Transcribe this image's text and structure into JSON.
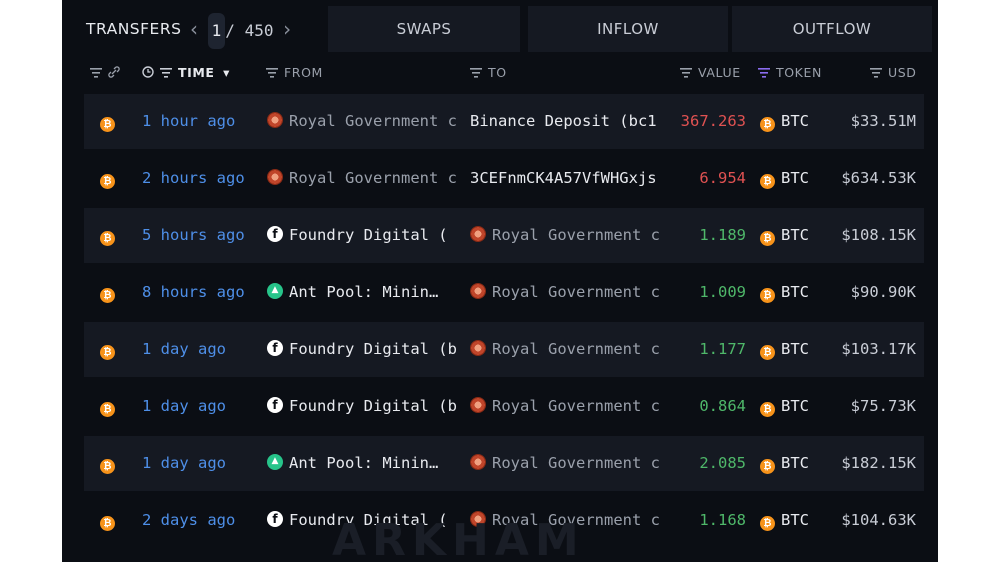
{
  "tabs": {
    "transfers": "TRANSFERS",
    "swaps": "SWAPS",
    "inflow": "INFLOW",
    "outflow": "OUTFLOW"
  },
  "pagination": {
    "prev": "‹",
    "current": "1",
    "separator": "/",
    "total": "450",
    "next": "›"
  },
  "columns": {
    "time": "TIME",
    "time_sort": "▾",
    "from": "FROM",
    "to": "TO",
    "value": "VALUE",
    "token": "TOKEN",
    "usd": "USD"
  },
  "colors": {
    "background": "#0b0e14",
    "row_alt": "#151922",
    "time_link": "#4e8fe8",
    "value_out": "#e05252",
    "value_in": "#4fb86a",
    "btc": "#f7931a",
    "token_filter": "#8b6cf0"
  },
  "rows": [
    {
      "time": "1 hour ago",
      "from": "Royal Government c",
      "from_icon": "royal-government-icon",
      "to": "Binance Deposit (bc1",
      "to_icon": "",
      "value": "367.263",
      "value_dir": "out",
      "token": "BTC",
      "usd": "$33.51M"
    },
    {
      "time": "2 hours ago",
      "from": "Royal Government c",
      "from_icon": "royal-government-icon",
      "to": "3CEFnmCK4A57VfWHGxjs",
      "to_icon": "",
      "value": "6.954",
      "value_dir": "out",
      "token": "BTC",
      "usd": "$634.53K"
    },
    {
      "time": "5 hours ago",
      "from": "Foundry Digital (",
      "from_icon": "foundry-digital-icon",
      "to": "Royal Government c",
      "to_icon": "royal-government-icon",
      "value": "1.189",
      "value_dir": "in",
      "token": "BTC",
      "usd": "$108.15K"
    },
    {
      "time": "8 hours ago",
      "from": "Ant Pool: Minin…",
      "from_icon": "ant-pool-icon",
      "to": "Royal Government c",
      "to_icon": "royal-government-icon",
      "value": "1.009",
      "value_dir": "in",
      "token": "BTC",
      "usd": "$90.90K"
    },
    {
      "time": "1 day ago",
      "from": "Foundry Digital (b",
      "from_icon": "foundry-digital-icon",
      "to": "Royal Government c",
      "to_icon": "royal-government-icon",
      "value": "1.177",
      "value_dir": "in",
      "token": "BTC",
      "usd": "$103.17K"
    },
    {
      "time": "1 day ago",
      "from": "Foundry Digital (b",
      "from_icon": "foundry-digital-icon",
      "to": "Royal Government c",
      "to_icon": "royal-government-icon",
      "value": "0.864",
      "value_dir": "in",
      "token": "BTC",
      "usd": "$75.73K"
    },
    {
      "time": "1 day ago",
      "from": "Ant Pool: Minin…",
      "from_icon": "ant-pool-icon",
      "to": "Royal Government c",
      "to_icon": "royal-government-icon",
      "value": "2.085",
      "value_dir": "in",
      "token": "BTC",
      "usd": "$182.15K"
    },
    {
      "time": "2 days ago",
      "from": "Foundry Digital (",
      "from_icon": "foundry-digital-icon",
      "to": "Royal Government c",
      "to_icon": "royal-government-icon",
      "value": "1.168",
      "value_dir": "in",
      "token": "BTC",
      "usd": "$104.63K"
    }
  ],
  "watermark": "ARKHAM"
}
